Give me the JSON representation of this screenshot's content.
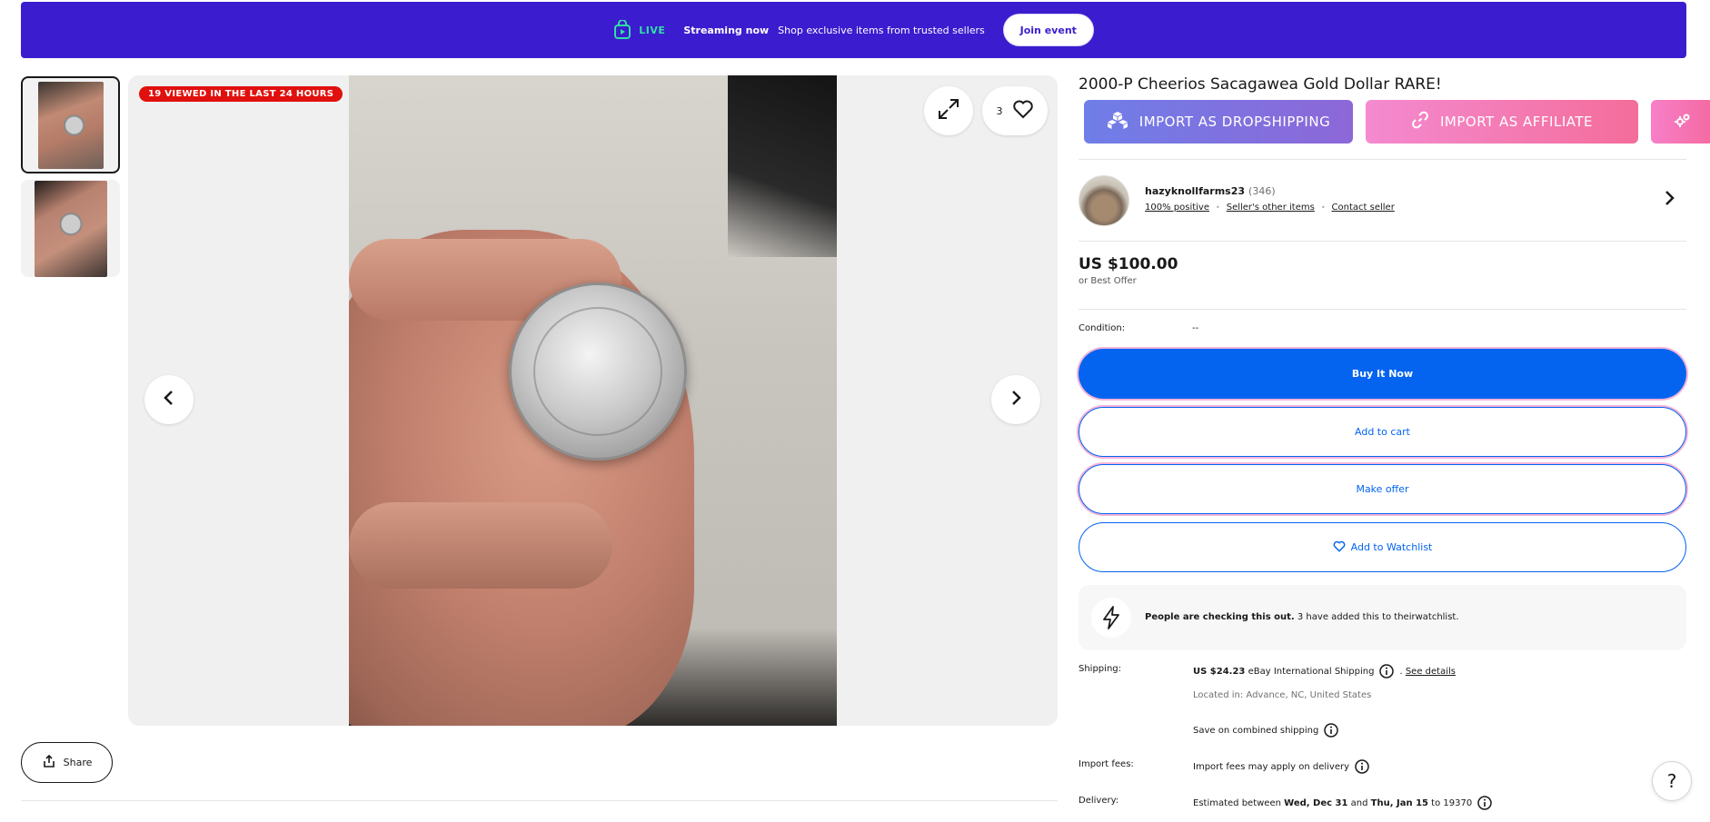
{
  "banner": {
    "live_label": "LIVE",
    "streaming_label": "Streaming now",
    "streaming_text": "Shop exclusive items from trusted sellers",
    "join_label": "Join event",
    "bg_color": "#3b1ccf"
  },
  "gallery": {
    "viewed_badge": "19 VIEWED IN THE LAST 24 HOURS",
    "watch_count": "3",
    "thumbnail_count": 2
  },
  "share": {
    "label": "Share"
  },
  "listing": {
    "title": "2000-P Cheerios Sacagawea Gold Dollar RARE!",
    "price": "US $100.00",
    "offer_text": "or Best Offer",
    "condition_label": "Condition:",
    "condition_value": "--"
  },
  "import_buttons": {
    "dropshipping": "IMPORT AS DROPSHIPPING",
    "affiliate": "IMPORT AS AFFILIATE"
  },
  "seller": {
    "name": "hazyknollfarms23",
    "count": "(346)",
    "positive": "100% positive",
    "other_items": "Seller's other items",
    "contact": "Contact seller"
  },
  "actions": {
    "buy_now": "Buy It Now",
    "add_to_cart": "Add to cart",
    "make_offer": "Make offer",
    "add_watchlist": "Add to Watchlist",
    "primary_color": "#0464f0"
  },
  "notice": {
    "bold": "People are checking this out.",
    "text": "3 have added this to theirwatchlist."
  },
  "shipping": {
    "label": "Shipping:",
    "price": "US $24.23",
    "method": "eBay International Shipping",
    "see_details": "See details",
    "located": "Located in: Advance, NC, United States",
    "combined": "Save on combined shipping"
  },
  "import_fees": {
    "label": "Import fees:",
    "text": "Import fees may apply on delivery"
  },
  "delivery": {
    "label": "Delivery:",
    "prefix": "Estimated between",
    "date1": "Wed, Dec 31",
    "and": "and",
    "date2": "Thu, Jan 15",
    "suffix": "to 19370"
  },
  "help": {
    "label": "?"
  }
}
